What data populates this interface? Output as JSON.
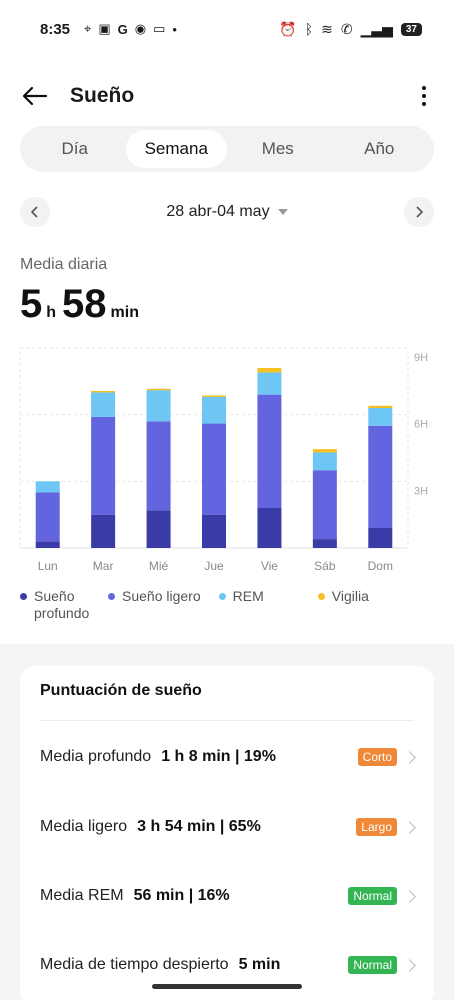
{
  "status_bar": {
    "time": "8:35",
    "left_icons": [
      "location-icon",
      "app-icon",
      "g-icon",
      "record-icon",
      "video-icon",
      "dot-icon"
    ],
    "right_icons": [
      "alarm-icon",
      "bluetooth-icon",
      "wifi-icon",
      "call-icon",
      "signal-icon"
    ],
    "battery": "37"
  },
  "header": {
    "title": "Sueño"
  },
  "tabs": [
    {
      "label": "Día",
      "active": false
    },
    {
      "label": "Semana",
      "active": true
    },
    {
      "label": "Mes",
      "active": false
    },
    {
      "label": "Año",
      "active": false
    }
  ],
  "date_range": {
    "label": "28 abr-04 may"
  },
  "summary": {
    "label": "Media diaria",
    "hours": "5",
    "hours_unit": "h",
    "minutes": "58",
    "minutes_unit": "min"
  },
  "colors": {
    "deep": "#3b3ba8",
    "light": "#6264e0",
    "rem": "#6ec6f5",
    "awake": "#f5c023"
  },
  "chart_data": {
    "type": "bar",
    "stacked": true,
    "categories": [
      "Lun",
      "Mar",
      "Mié",
      "Jue",
      "Vie",
      "Sáb",
      "Dom"
    ],
    "series": [
      {
        "name": "Sueño profundo",
        "values": [
          0.3,
          1.5,
          1.7,
          1.5,
          1.8,
          0.4,
          0.9
        ]
      },
      {
        "name": "Sueño ligero",
        "values": [
          2.2,
          4.4,
          4.0,
          4.1,
          5.1,
          3.1,
          4.6
        ]
      },
      {
        "name": "REM",
        "values": [
          0.5,
          1.1,
          1.4,
          1.2,
          1.0,
          0.8,
          0.8
        ]
      },
      {
        "name": "Vigilia",
        "values": [
          0,
          0.05,
          0.05,
          0.05,
          0.2,
          0.15,
          0.1
        ]
      }
    ],
    "y_tick_labels": [
      "9H",
      "6H",
      "3H"
    ],
    "y_ticks": [
      9,
      6,
      3
    ],
    "ylim": [
      0,
      9
    ],
    "grid": true,
    "legend_position": "bottom"
  },
  "legend": [
    {
      "label": "Sueño profundo"
    },
    {
      "label": "Sueño ligero"
    },
    {
      "label": "REM"
    },
    {
      "label": "Vigilia"
    }
  ],
  "score_card": {
    "title": "Puntuación de sueño",
    "rows": [
      {
        "label": "Media profundo",
        "value": "1 h 8 min | 19%",
        "badge": "Corto",
        "badge_color": "#f0883a"
      },
      {
        "label": "Media ligero",
        "value": "3 h 54 min | 65%",
        "badge": "Largo",
        "badge_color": "#f0883a"
      },
      {
        "label": "Media REM",
        "value": "56 min | 16%",
        "badge": "Normal",
        "badge_color": "#32b552"
      },
      {
        "label": "Media de tiempo despierto",
        "value": "5 min",
        "badge": "Normal",
        "badge_color": "#32b552"
      }
    ]
  }
}
